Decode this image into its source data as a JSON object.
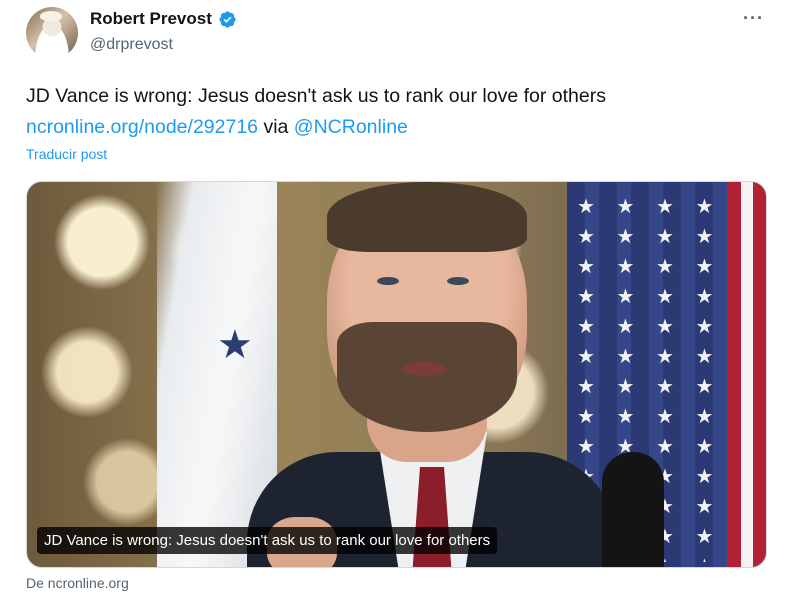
{
  "author": {
    "display_name": "Robert Prevost",
    "handle": "@drprevost",
    "verified": true
  },
  "menu_glyph": "···",
  "tweet": {
    "text_main": "JD Vance is wrong: Jesus doesn't ask us to rank our love for others",
    "link_text": "ncronline.org/node/292716",
    "via_text": " via ",
    "mention_text": "@NCRonline",
    "translate_label": "Traducir post"
  },
  "card": {
    "caption": "JD Vance is wrong: Jesus doesn't ask us to rank our love for others",
    "source": "De ncronline.org"
  },
  "colors": {
    "accent": "#1d9bf0",
    "text": "#0f1419",
    "muted": "#536471"
  },
  "icons": {
    "verified": "verified-badge-icon",
    "more": "more-options-icon"
  }
}
